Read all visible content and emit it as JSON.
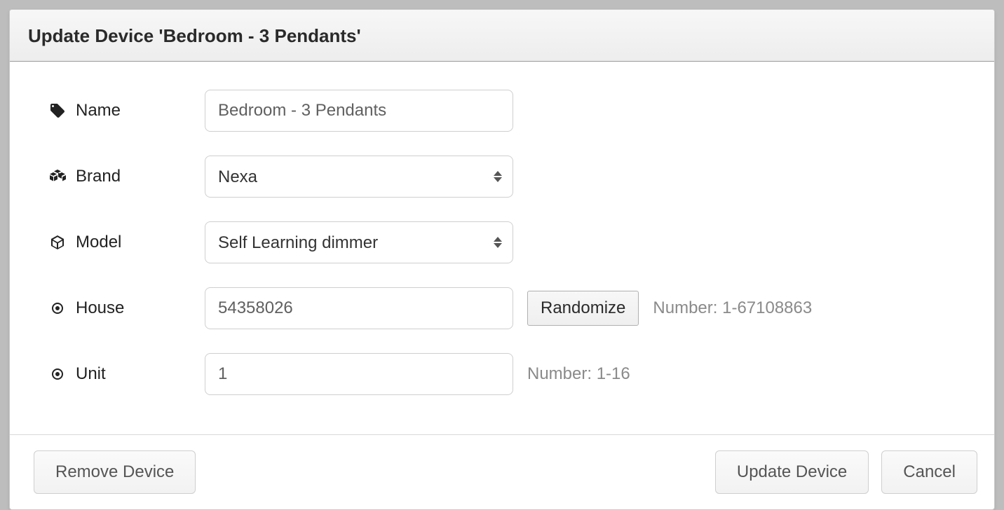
{
  "header": {
    "title": "Update Device 'Bedroom - 3 Pendants'"
  },
  "labels": {
    "name": "Name",
    "brand": "Brand",
    "model": "Model",
    "house": "House",
    "unit": "Unit"
  },
  "fields": {
    "name_value": "Bedroom - 3 Pendants",
    "brand_value": "Nexa",
    "model_value": "Self Learning dimmer",
    "house_value": "54358026",
    "unit_value": "1"
  },
  "hints": {
    "house": "Number: 1-67108863",
    "unit": "Number: 1-16"
  },
  "buttons": {
    "randomize": "Randomize",
    "remove": "Remove Device",
    "update": "Update Device",
    "cancel": "Cancel"
  }
}
